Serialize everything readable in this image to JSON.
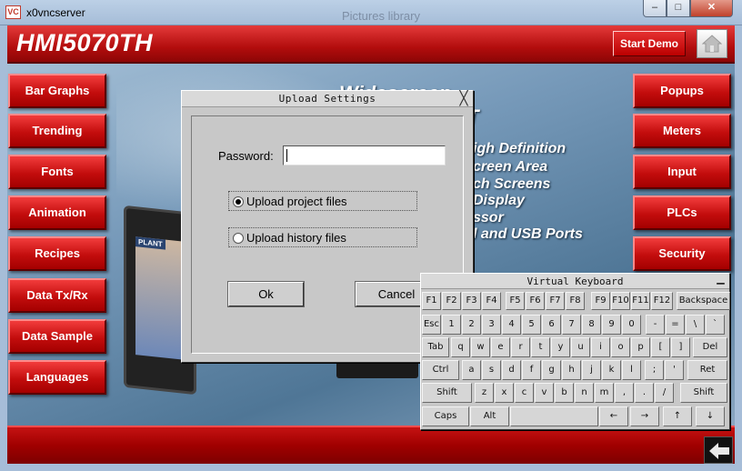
{
  "window": {
    "title": "x0vncserver",
    "icon_text": "VC",
    "background_title": "Pictures library",
    "minimize": "–",
    "maximize": "□",
    "close": "✕"
  },
  "hmi": {
    "title": "HMI5070TH",
    "start_demo": "Start Demo",
    "left_buttons": [
      "Bar Graphs",
      "Trending",
      "Fonts",
      "Animation",
      "Recipes",
      "Data Tx/Rx",
      "Data Sample",
      "Languages"
    ],
    "right_buttons": [
      "Popups",
      "Meters",
      "Input",
      "PLCs",
      "Security"
    ],
    "device_label": "PLANT",
    "promo_lines": [
      "Widescreen",
      "T",
      "igh Definition",
      "creen Area",
      "ch Screens",
      "Display",
      "ssor",
      "l and USB Ports"
    ]
  },
  "dialog": {
    "title": "Upload Settings",
    "close": "╳",
    "password_label": "Password:",
    "password_value": "",
    "options": [
      {
        "label": "Upload project files",
        "selected": true
      },
      {
        "label": "Upload history files",
        "selected": false
      }
    ],
    "ok_label": "Ok",
    "cancel_label": "Cancel"
  },
  "keyboard": {
    "title": "Virtual Keyboard",
    "minimize": "▁",
    "rows": [
      [
        "F1",
        "F2",
        "F3",
        "F4",
        "F5",
        "F6",
        "F7",
        "F8",
        "F9",
        "F10",
        "F11",
        "F12",
        "Backspace"
      ],
      [
        "Esc",
        "1",
        "2",
        "3",
        "4",
        "5",
        "6",
        "7",
        "8",
        "9",
        "0",
        "-",
        "=",
        "\\",
        "`"
      ],
      [
        "Tab",
        "q",
        "w",
        "e",
        "r",
        "t",
        "y",
        "u",
        "i",
        "o",
        "p",
        "[",
        "]",
        "Del"
      ],
      [
        "Ctrl",
        "a",
        "s",
        "d",
        "f",
        "g",
        "h",
        "j",
        "k",
        "l",
        ";",
        "'",
        "Ret"
      ],
      [
        "Shift",
        "z",
        "x",
        "c",
        "v",
        "b",
        "n",
        "m",
        ",",
        ".",
        "/",
        "Shift"
      ],
      [
        "Caps",
        "Alt",
        "",
        "←",
        "→",
        "↑",
        "↓"
      ]
    ]
  }
}
